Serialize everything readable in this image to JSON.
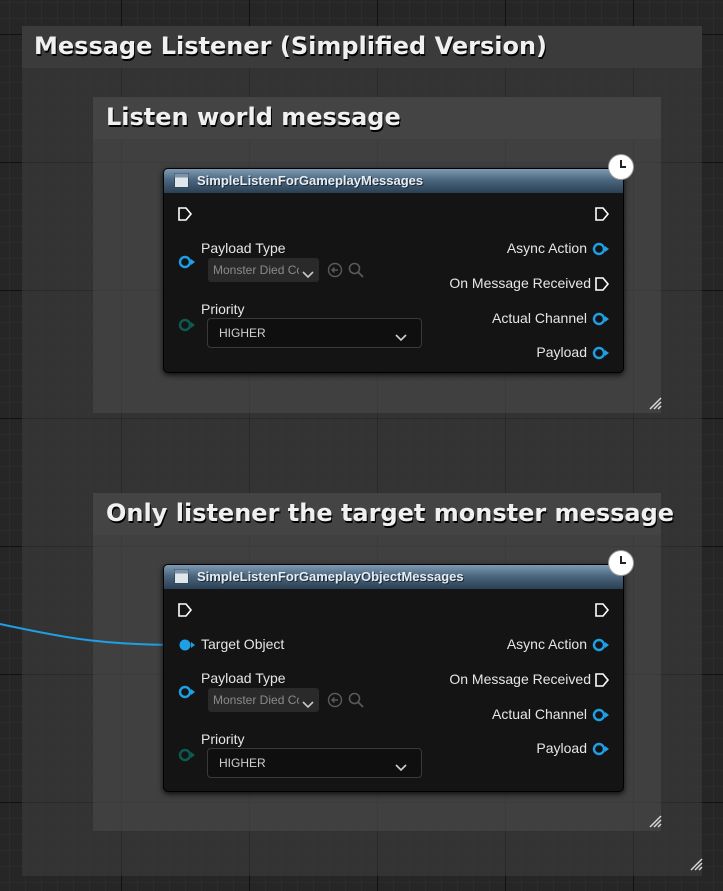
{
  "comments": {
    "outer_title": "Message Listener (Simplified Version)",
    "world_title": "Listen world message",
    "target_title": "Only listener the target monster message"
  },
  "node1": {
    "title": "SimpleListenForGameplayMessages",
    "inputs": {
      "payload_type_label": "Payload Type",
      "payload_type_value": "Monster Died Co",
      "priority_label": "Priority",
      "priority_value": "HIGHER"
    },
    "outputs": {
      "async_action": "Async Action",
      "on_message_received": "On Message Received",
      "actual_channel": "Actual Channel",
      "payload": "Payload"
    }
  },
  "node2": {
    "title": "SimpleListenForGameplayObjectMessages",
    "inputs": {
      "target_object_label": "Target Object",
      "payload_type_label": "Payload Type",
      "payload_type_value": "Monster Died Co",
      "priority_label": "Priority",
      "priority_value": "HIGHER"
    },
    "outputs": {
      "async_action": "Async Action",
      "on_message_received": "On Message Received",
      "actual_channel": "Actual Channel",
      "payload": "Payload"
    }
  },
  "colors": {
    "object_pin": "#1e9fe6",
    "enum_pin": "#0c5a52",
    "exec_pin": "#ffffff",
    "wire": "#1e9fe6"
  },
  "icons": {
    "latent": "clock-icon",
    "function": "function-icon",
    "use_selected": "arrow-left-circle-icon",
    "browse": "magnifier-icon"
  }
}
